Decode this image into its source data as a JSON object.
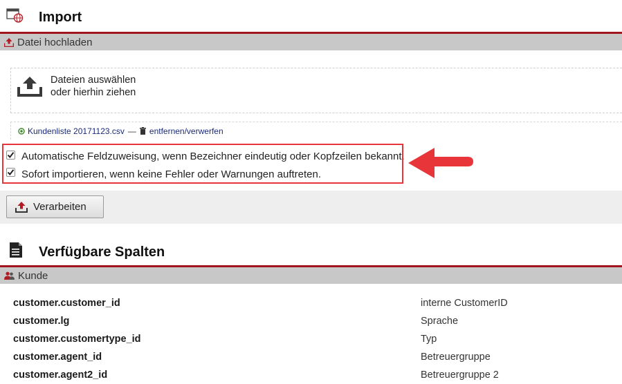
{
  "header": {
    "title": "Import",
    "icon": "globe-window-icon"
  },
  "upload_section": {
    "title": "Datei hochladen",
    "icon": "upload-icon",
    "dropzone": {
      "line1": "Dateien auswählen",
      "line2": "oder hierhin ziehen",
      "icon": "upload-tray-icon"
    },
    "file": {
      "name": "Kundenliste 20171123.csv",
      "separator": "—",
      "remove_label": "entfernen/verwerfen"
    }
  },
  "options": [
    {
      "label": "Automatische Feldzuweisung, wenn Bezeichner eindeutig oder Kopfzeilen bekannt.",
      "checked": true
    },
    {
      "label": "Sofort importieren, wenn keine Fehler oder Warnungen auftreten.",
      "checked": true
    }
  ],
  "annotation": {
    "highlight_color": "#e8353a",
    "arrow_color": "#e8353a"
  },
  "process_button": {
    "label": "Verarbeiten"
  },
  "columns_section": {
    "title": "Verfügbare Spalten",
    "icon": "document-icon",
    "group": {
      "title": "Kunde",
      "icon": "users-icon"
    },
    "rows": [
      {
        "key": "customer.customer_id",
        "desc": "interne CustomerID"
      },
      {
        "key": "customer.lg",
        "desc": "Sprache"
      },
      {
        "key": "customer.customertype_id",
        "desc": "Typ"
      },
      {
        "key": "customer.agent_id",
        "desc": "Betreuergruppe"
      },
      {
        "key": "customer.agent2_id",
        "desc": "Betreuergruppe 2"
      }
    ]
  },
  "colors": {
    "accent": "#a0141e",
    "bar": "#c8c8c8",
    "link": "#1a2a7a"
  }
}
